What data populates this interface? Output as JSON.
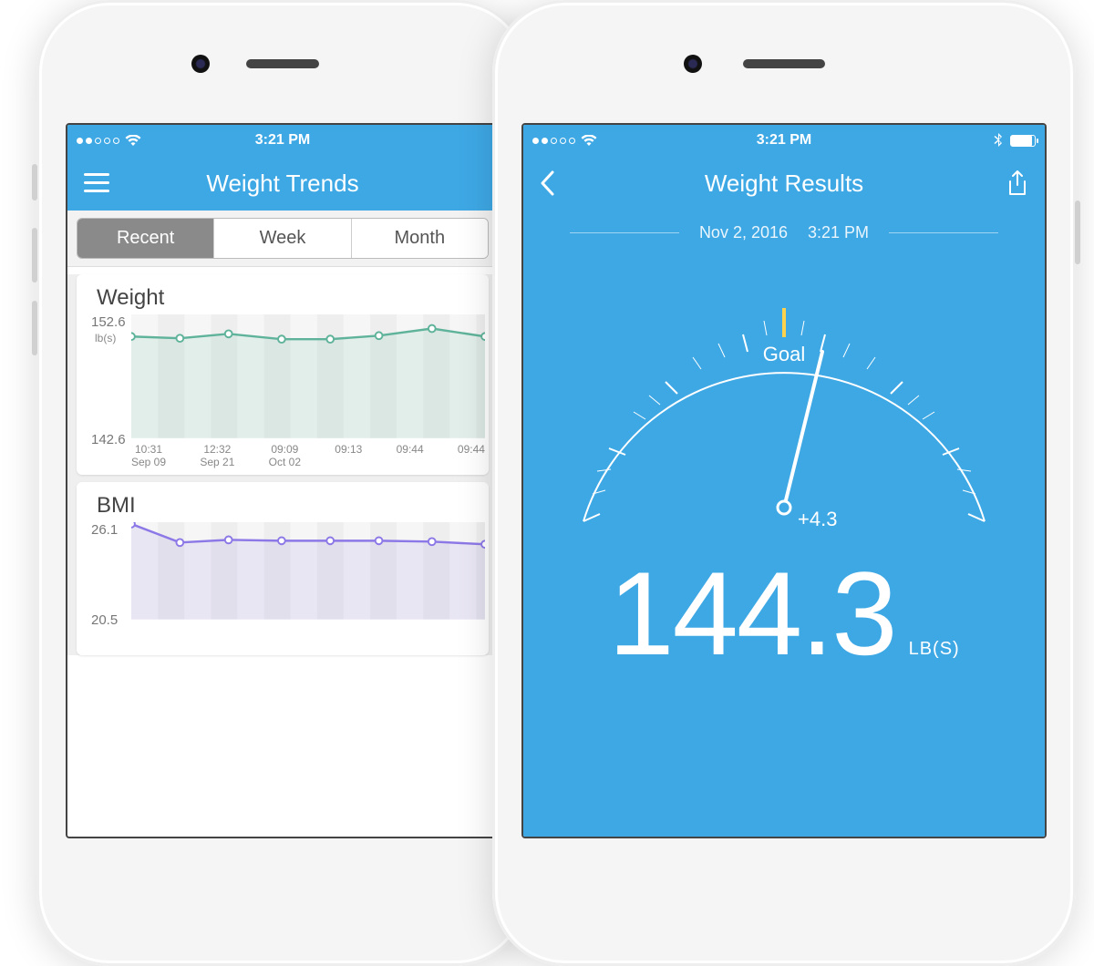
{
  "status_time": "3:21 PM",
  "left_screen": {
    "title": "Weight Trends",
    "tabs": [
      "Recent",
      "Week",
      "Month"
    ],
    "tab_active_index": 0,
    "weight_chart": {
      "title": "Weight",
      "ymax_label": "152.6",
      "ymin_label": "142.6",
      "yunit": "lb(s)",
      "xticks": [
        {
          "t": "10:31",
          "d": "Sep 09"
        },
        {
          "t": "12:32",
          "d": "Sep 21"
        },
        {
          "t": "09:09",
          "d": "Oct 02"
        },
        {
          "t": "09:13",
          "d": ""
        },
        {
          "t": "09:44",
          "d": ""
        },
        {
          "t": "09:44",
          "d": ""
        }
      ]
    },
    "bmi_chart": {
      "title": "BMI",
      "ymax_label": "26.1",
      "ymin_label": "20.5"
    }
  },
  "right_screen": {
    "title": "Weight Results",
    "date": "Nov 2, 2016",
    "time": "3:21 PM",
    "goal_label": "Goal",
    "delta": "+4.3",
    "weight_value": "144.3",
    "weight_unit": "LB(S)"
  },
  "chart_data": [
    {
      "type": "line",
      "title": "Weight",
      "ylabel": "lb(s)",
      "ylim": [
        142.6,
        152.6
      ],
      "categories": [
        "10:31 Sep 09",
        "12:32 Sep 21",
        "09:09 Oct 02",
        "09:13",
        "09:44",
        "09:44"
      ],
      "values": [
        151.0,
        150.8,
        151.4,
        150.6,
        150.6,
        151.2,
        152.1,
        151.0
      ]
    },
    {
      "type": "line",
      "title": "BMI",
      "ylim": [
        20.5,
        26.1
      ],
      "categories": [
        "10:31 Sep 09",
        "12:32 Sep 21",
        "09:09 Oct 02",
        "09:13",
        "09:44",
        "09:44"
      ],
      "values": [
        26.1,
        24.9,
        25.2,
        25.1,
        25.1,
        25.1,
        25.0,
        24.8
      ]
    }
  ]
}
